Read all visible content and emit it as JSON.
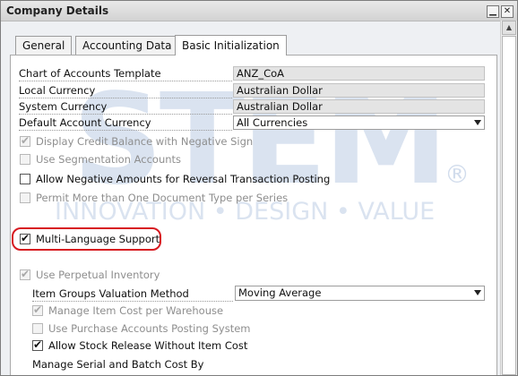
{
  "window": {
    "title": "Company Details"
  },
  "tabs": [
    {
      "label": "General",
      "mnemonic": "n",
      "active": false
    },
    {
      "label": "Accounting Data",
      "mnemonic": "A",
      "active": false
    },
    {
      "label": "Basic Initialization",
      "mnemonic": "B",
      "active": true
    }
  ],
  "fields": [
    {
      "label": "Chart of Accounts Template",
      "value": "ANZ_CoA",
      "type": "readonly"
    },
    {
      "label": "Local Currency",
      "value": "Australian Dollar",
      "type": "readonly"
    },
    {
      "label": "System Currency",
      "value": "Australian Dollar",
      "type": "readonly"
    },
    {
      "label": "Default Account Currency",
      "value": "All Currencies",
      "type": "select"
    }
  ],
  "checkboxes": [
    {
      "label": "Display Credit Balance with Negative Sign",
      "checked": true,
      "disabled": true
    },
    {
      "label": "Use Segmentation Accounts",
      "checked": false,
      "disabled": true
    },
    {
      "label": "Allow Negative Amounts for Reversal Transaction Posting",
      "checked": false,
      "disabled": false
    },
    {
      "label": "Permit More than One Document Type per Series",
      "checked": false,
      "disabled": true
    },
    {
      "label": "Multi-Language Support",
      "checked": true,
      "disabled": false,
      "highlighted": true
    },
    {
      "label": "Use Perpetual Inventory",
      "checked": true,
      "disabled": true
    },
    {
      "label": "Manage Item Cost per Warehouse",
      "checked": true,
      "disabled": true
    },
    {
      "label": "Use Purchase Accounts Posting System",
      "checked": false,
      "disabled": true
    },
    {
      "label": "Allow Stock Release Without Item Cost",
      "checked": true,
      "disabled": false
    }
  ],
  "valuation": {
    "label": "Item Groups Valuation Method",
    "value": "Moving Average"
  },
  "serial_batch": {
    "label": "Manage Serial and Batch Cost By"
  },
  "watermark": {
    "brand": "STEM",
    "tagline": "INNOVATION • DESIGN • VALUE",
    "registered": "®"
  },
  "colors": {
    "highlight": "#d71920",
    "watermark": "#1a4fa0"
  },
  "icons": {
    "minimize": "minimize-icon",
    "close": "close-icon",
    "scroll_up": "scroll-up-arrow-icon",
    "dropdown": "dropdown-arrow-icon",
    "check": "checkmark-icon"
  }
}
